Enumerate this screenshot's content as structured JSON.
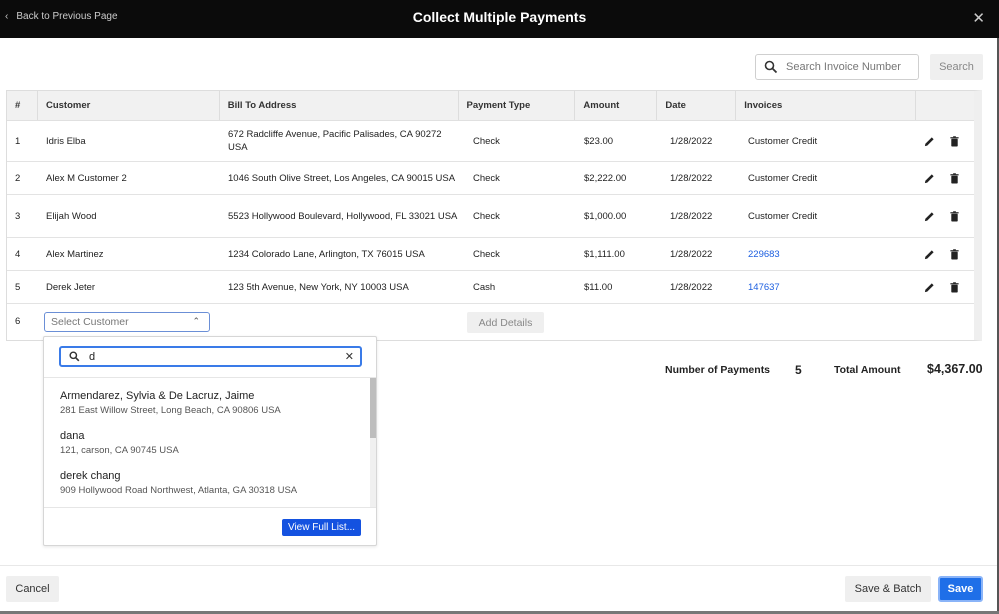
{
  "header": {
    "back_label": "Back to Previous Page",
    "title": "Collect Multiple Payments",
    "close_icon": "close-icon"
  },
  "search": {
    "placeholder": "Search Invoice Number",
    "value": "",
    "button_label": "Search"
  },
  "table": {
    "columns": [
      "#",
      "Customer",
      "Bill To Address",
      "Payment Type",
      "Amount",
      "Date",
      "Invoices",
      ""
    ],
    "rows": [
      {
        "num": "1",
        "customer": "Idris Elba",
        "address": "672 Radcliffe Avenue, Pacific Palisades, CA 90272 USA",
        "payment_type": "Check",
        "amount": "$23.00",
        "date": "1/28/2022",
        "invoices": "Customer Credit",
        "invoice_is_link": false
      },
      {
        "num": "2",
        "customer": "Alex M Customer 2",
        "address": "1046 South Olive Street, Los Angeles, CA 90015 USA",
        "payment_type": "Check",
        "amount": "$2,222.00",
        "date": "1/28/2022",
        "invoices": "Customer Credit",
        "invoice_is_link": false
      },
      {
        "num": "3",
        "customer": "Elijah Wood",
        "address": "5523 Hollywood Boulevard, Hollywood, FL 33021 USA",
        "payment_type": "Check",
        "amount": "$1,000.00",
        "date": "1/28/2022",
        "invoices": "Customer Credit",
        "invoice_is_link": false
      },
      {
        "num": "4",
        "customer": "Alex Martinez",
        "address": "1234 Colorado Lane, Arlington, TX 76015 USA",
        "payment_type": "Check",
        "amount": "$1,111.00",
        "date": "1/28/2022",
        "invoices": "229683",
        "invoice_is_link": true
      },
      {
        "num": "5",
        "customer": "Derek Jeter",
        "address": "123 5th Avenue, New York, NY 10003 USA",
        "payment_type": "Cash",
        "amount": "$11.00",
        "date": "1/28/2022",
        "invoices": "147637",
        "invoice_is_link": true
      }
    ],
    "new_row": {
      "num": "6",
      "select_placeholder": "Select Customer",
      "add_details_label": "Add Details"
    }
  },
  "customer_dropdown": {
    "search_value": "d",
    "options": [
      {
        "name": "Armendarez, Sylvia & De Lacruz, Jaime",
        "address": "281 East Willow Street, Long Beach, CA 90806 USA"
      },
      {
        "name": "dana",
        "address": "121, carson, CA 90745 USA"
      },
      {
        "name": "derek chang",
        "address": "909 Hollywood Road Northwest, Atlanta, GA 30318 USA"
      }
    ],
    "view_full_label": "View Full List..."
  },
  "summary": {
    "payments_label": "Number of Payments",
    "payments_count": "5",
    "total_label": "Total Amount",
    "total_value": "$4,367.00"
  },
  "footer": {
    "cancel_label": "Cancel",
    "save_batch_label": "Save & Batch",
    "save_label": "Save"
  },
  "colors": {
    "header_bg": "#0b0b0b",
    "link": "#1d5fe0",
    "primary": "#1f6fe8",
    "view_full_bg": "#1452e0"
  }
}
